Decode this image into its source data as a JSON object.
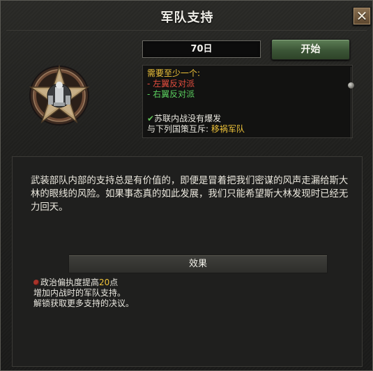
{
  "title": "军队支持",
  "close_icon": "close-icon",
  "days": "70日",
  "start_label": "开始",
  "requirements": {
    "header": "需要至少一个:",
    "left_faction": "- 左翼反对派",
    "right_faction": "- 右翼反对派",
    "civil_war_prefix": "✔",
    "civil_war": "苏联内战没有爆发",
    "exclusive_label": "与下列国策互斥:",
    "exclusive_value": "移祸军队"
  },
  "description": "武装部队内部的支持总是有价值的，即便是冒着把我们密谋的风声走漏给斯大林的眼线的风险。如果事态真的如此发展，我们只能希望斯大林发现时已经无力回天。",
  "effects": {
    "header": "效果",
    "line1_prefix": "政治偏执度提高",
    "line1_value": "20",
    "line1_suffix": "点",
    "line2": "增加内战时的军队支持。",
    "line3": "解锁获取更多支持的决议。"
  },
  "colors": {
    "gold": "#f0c43a",
    "red": "#e34d3e",
    "green": "#5bd05f",
    "button_green": "#3b5536",
    "close_bronze": "#8a7152"
  }
}
